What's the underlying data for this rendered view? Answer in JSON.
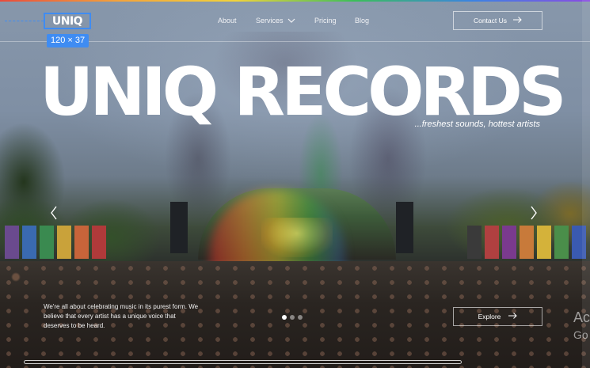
{
  "brand": {
    "logo_text": "UNIQ",
    "accent": "#3f8cf2"
  },
  "selection": {
    "dimensions": "120 × 37"
  },
  "nav": {
    "items": [
      {
        "label": "About"
      },
      {
        "label": "Services"
      },
      {
        "label": "Pricing"
      },
      {
        "label": "Blog"
      }
    ],
    "services_icon": "chevron-down-icon",
    "contact_label": "Contact Us",
    "contact_icon": "arrow-right-icon"
  },
  "hero": {
    "title": "UNIQ RECORDS",
    "tagline": "...freshest sounds, hottest artists",
    "blurb": "We're all about celebrating music in its purest form. We believe that every artist has a unique voice that deserves to be heard.",
    "explore_label": "Explore",
    "explore_icon": "arrow-right-icon",
    "prev_icon": "chevron-left-icon",
    "next_icon": "chevron-right-icon"
  },
  "slider": {
    "dots": 3,
    "active_index": 0,
    "next_peek_line1": "Ac",
    "next_peek_line2": "Go"
  }
}
